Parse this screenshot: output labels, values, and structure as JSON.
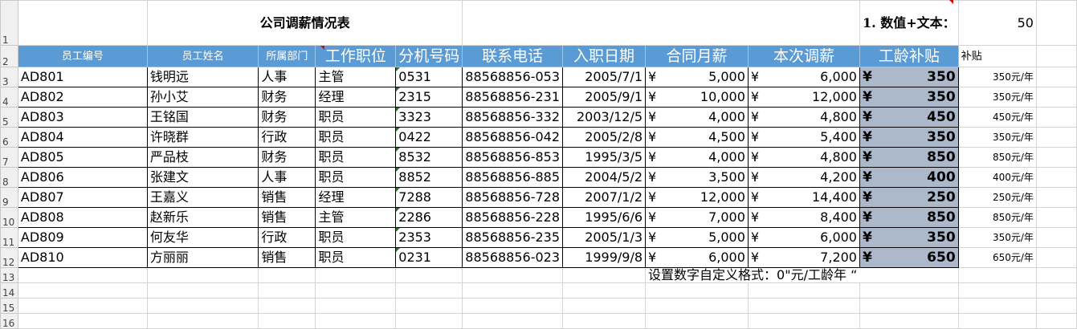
{
  "sheet": {
    "title": "公司调薪情况表",
    "note_red": "1. 数值+文本：",
    "cell_value": "50",
    "headers": [
      "员工编号",
      "员工姓名",
      "所属部门",
      "工作职位",
      "分机号码",
      "联系电话",
      "入职日期",
      "合同月薪",
      "本次调薪",
      "工龄补贴",
      "补贴"
    ],
    "currency": "¥",
    "rows": [
      {
        "id": "AD801",
        "name": "钱明远",
        "dept": "人事",
        "pos": "主管",
        "ext": "0531",
        "phone": "88568856-053",
        "date": "2005/7/1",
        "salary": "5,000",
        "raise": "6,000",
        "seniority": "350",
        "sub": "350元/年"
      },
      {
        "id": "AD802",
        "name": "孙小艾",
        "dept": "财务",
        "pos": "经理",
        "ext": "2315",
        "phone": "88568856-231",
        "date": "2005/9/1",
        "salary": "10,000",
        "raise": "12,000",
        "seniority": "350",
        "sub": "350元/年"
      },
      {
        "id": "AD803",
        "name": "王铭国",
        "dept": "财务",
        "pos": "职员",
        "ext": "3323",
        "phone": "88568856-332",
        "date": "2003/12/5",
        "salary": "4,000",
        "raise": "4,800",
        "seniority": "450",
        "sub": "450元/年"
      },
      {
        "id": "AD804",
        "name": "许晓群",
        "dept": "行政",
        "pos": "职员",
        "ext": "0422",
        "phone": "88568856-042",
        "date": "2005/2/8",
        "salary": "4,500",
        "raise": "5,400",
        "seniority": "350",
        "sub": "350元/年"
      },
      {
        "id": "AD805",
        "name": "严品枝",
        "dept": "财务",
        "pos": "职员",
        "ext": "8532",
        "phone": "88568856-853",
        "date": "1995/3/5",
        "salary": "4,000",
        "raise": "4,800",
        "seniority": "850",
        "sub": "850元/年"
      },
      {
        "id": "AD806",
        "name": "张建文",
        "dept": "人事",
        "pos": "职员",
        "ext": "8852",
        "phone": "88568856-885",
        "date": "2004/5/2",
        "salary": "3,500",
        "raise": "4,200",
        "seniority": "400",
        "sub": "400元/年"
      },
      {
        "id": "AD807",
        "name": "王嘉义",
        "dept": "销售",
        "pos": "经理",
        "ext": "7288",
        "phone": "88568856-728",
        "date": "2007/1/2",
        "salary": "12,000",
        "raise": "14,400",
        "seniority": "250",
        "sub": "250元/年"
      },
      {
        "id": "AD808",
        "name": "赵新乐",
        "dept": "销售",
        "pos": "主管",
        "ext": "2286",
        "phone": "88568856-228",
        "date": "1995/6/6",
        "salary": "7,000",
        "raise": "8,400",
        "seniority": "850",
        "sub": "850元/年"
      },
      {
        "id": "AD809",
        "name": "何友华",
        "dept": "行政",
        "pos": "职员",
        "ext": "2353",
        "phone": "88568856-235",
        "date": "2005/1/3",
        "salary": "5,000",
        "raise": "6,000",
        "seniority": "350",
        "sub": "350元/年"
      },
      {
        "id": "AD810",
        "name": "方丽丽",
        "dept": "销售",
        "pos": "职员",
        "ext": "0231",
        "phone": "88568856-023",
        "date": "1999/9/8",
        "salary": "6,000",
        "raise": "7,200",
        "seniority": "650",
        "sub": "650元/年"
      }
    ],
    "footnote": "设置数字自定义格式：0\"元/工龄年 “",
    "row_numbers": [
      "1",
      "2",
      "3",
      "4",
      "5",
      "6",
      "7",
      "8",
      "9",
      "10",
      "11",
      "12",
      "13",
      "14",
      "15",
      "16"
    ]
  }
}
